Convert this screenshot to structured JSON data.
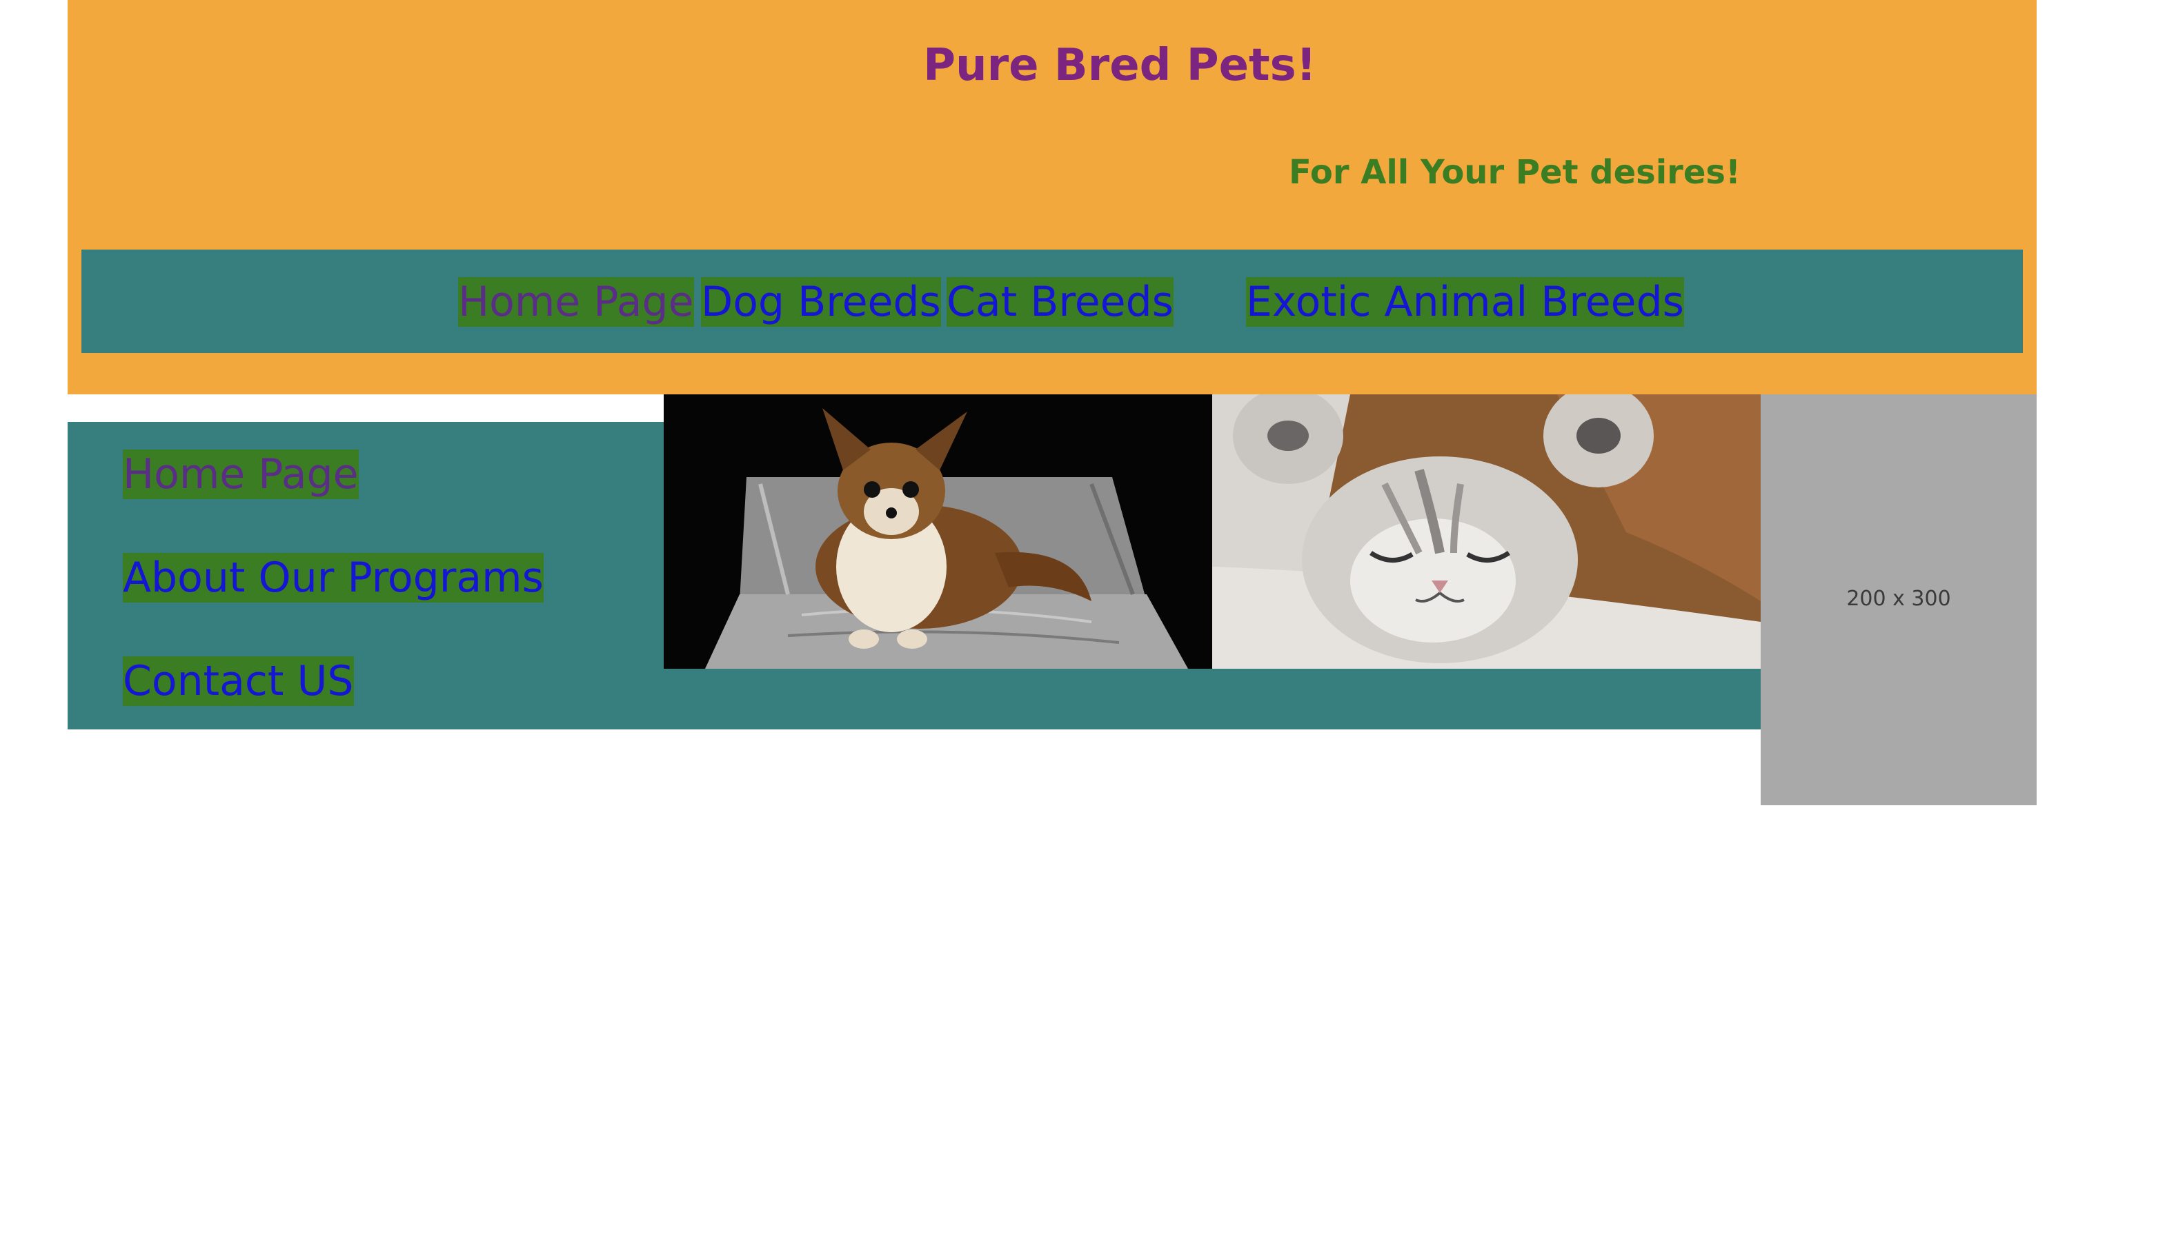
{
  "header": {
    "title": "Pure Bred Pets!",
    "tagline": "For All Your Pet desires!"
  },
  "top_nav": {
    "items": [
      {
        "label": "Home Page"
      },
      {
        "label": "Dog Breeds"
      },
      {
        "label": "Cat Breeds"
      },
      {
        "label": "Exotic Animal Breeds"
      }
    ]
  },
  "side_nav": {
    "items": [
      {
        "label": "Home Page"
      },
      {
        "label": "About Our Programs"
      },
      {
        "label": "Contact US"
      }
    ]
  },
  "placeholder": {
    "label": "200 x 300"
  },
  "colors": {
    "header_bg": "#f2a83c",
    "nav_bg": "#377e7e",
    "link_bg": "#3a7d22",
    "link_text": "#1515d6",
    "visited_link_text": "#5a2d86",
    "title_color": "#7b2580",
    "tagline_color": "#3a7d22",
    "placeholder_bg": "#a9a9a9"
  }
}
